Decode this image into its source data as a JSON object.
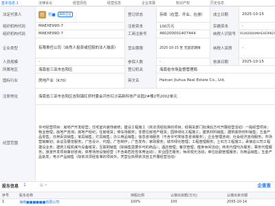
{
  "tabs": [
    "基本信息 1",
    "法律诉讼",
    "经营风险",
    "经营信息",
    "企业发展",
    "知识产权",
    "历史信息"
  ],
  "rows": {
    "legal_rep_label": "法定代表人",
    "legal_rep_avatar": "符",
    "legal_rep_name": "符■",
    "legal_rep_badge": "关联企业",
    "reg_status_label": "登记状态",
    "reg_status": "存续（在营、开业、在册）",
    "est_date_label": "成立日期",
    "est_date": "2025-10-15",
    "org_code_label": "组织机构代码",
    "org_code": "MAEXE99D-7",
    "reg_capital_label": "注册资本",
    "reg_capital": "100万元",
    "paid_capital_label": "实缴资本",
    "paid_capital": "-",
    "org_code2_label": "组织机构代码",
    "org_code2": "MAEXE99D-7",
    "biz_no_label": "工商注册号",
    "biz_no": "460200001407444",
    "tax_no_label": "纳税人识别号",
    "tax_no": "91460000MAEXE99D7F",
    "type_label": "企业类型",
    "type": "有限责任公司（自然人投资或控股的法人独资）",
    "term_label": "营业期限",
    "term": "2025-10-15 至 无固定期限",
    "taxpayer_label": "纳税人资质",
    "taxpayer": "-",
    "staff_label": "人员规模",
    "staff": "-",
    "insured_label": "参保人数",
    "insured": "-",
    "approve_label": "核准日期",
    "approve": "2025-10-15",
    "area_label": "所属地区",
    "area": "海南省三亚市吉阳区",
    "authority_label": "登记机关",
    "authority": "海南省市场监督管理局",
    "industry_label": "国标行业",
    "industry": "房地产业（K70）",
    "en_label": "英文名",
    "en_name": "Hainan Jiuhua Real Estate Co., Ltd.",
    "addr_label": "注册地址",
    "addr": "海南省三亚市吉阳区吉阳镇红郊村委会河东红沙高新科技产业园2#楼2号2002单元",
    "scope_label": "经营范围",
    "scope": "许可经营项目：房地产开发经营；住宅室内装饰装修；建设工程施工（依法须经批准的项目，经相关部门批准后方可开展经营活动）一般经营项目：物业管理；房地产咨询；房地产经纪；住房租赁；停车场服务；非居住房地产租赁；园林绿化工程施工；建筑材料销售；建筑装饰材料销售；五金产品零售；日用百货销售；家具销售；灯具销售；办公用品销售；信息咨询服务（不含许可类信息咨询服务）；企业管理咨询；社会经济咨询服务；市场营销策划；会议及展览服务；广告设计、代理；广告制作；广告发布；家政服务；城市绿化管理；工程管理服务；土石方工程施工；承接总公司工程建设业务；建筑工程机械与设备租赁；互联网销售（除销售需要许可的商品）；酒店管理；餐饮管理；健身休闲活动；商务代理代办服务；票务代理服务；旅游开发项目策划咨询；体育场地设施经营（不含高危险性体育运动）；农业园艺服务；休闲观光活动；单位后勤管理服务；日用品销售；五金产品批发；电子产品销售（除依法须经批准的项目外，凭营业执照依法自主开展经营活动）"
  },
  "footer": {
    "title": "股东信息",
    "count": "1",
    "icons": "▤ ↗",
    "brand": "企查查",
    "head": [
      "序号",
      "股东名称",
      "持股比例",
      "认缴出资额(万元)",
      "认缴出资日期"
    ],
    "row": [
      "1",
      "海南■■■■■■有限公司",
      "100%",
      "100",
      "2055-10-14"
    ]
  }
}
